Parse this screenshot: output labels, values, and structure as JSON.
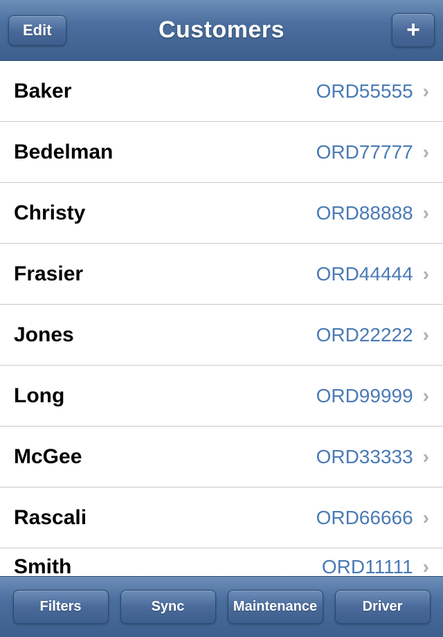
{
  "header": {
    "title": "Customers",
    "edit_button": "Edit",
    "add_button": "+"
  },
  "customers": [
    {
      "name": "Baker",
      "order": "ORD55555"
    },
    {
      "name": "Bedelman",
      "order": "ORD77777"
    },
    {
      "name": "Christy",
      "order": "ORD88888"
    },
    {
      "name": "Frasier",
      "order": "ORD44444"
    },
    {
      "name": "Jones",
      "order": "ORD22222"
    },
    {
      "name": "Long",
      "order": "ORD99999"
    },
    {
      "name": "McGee",
      "order": "ORD33333"
    },
    {
      "name": "Rascali",
      "order": "ORD66666"
    },
    {
      "name": "Smith",
      "order": "ORD11111"
    }
  ],
  "toolbar": {
    "filters": "Filters",
    "sync": "Sync",
    "maintenance": "Maintenance",
    "driver": "Driver"
  }
}
